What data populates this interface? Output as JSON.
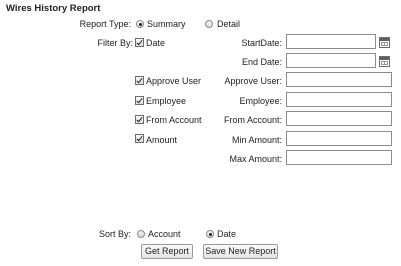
{
  "title": "Wires History Report",
  "report_type": {
    "label": "Report Type:",
    "options": [
      {
        "label": "Summary",
        "selected": true
      },
      {
        "label": "Detail",
        "selected": false
      }
    ]
  },
  "filter_by": {
    "label": "Filter By:",
    "options": [
      {
        "label": "Date",
        "checked": true
      },
      {
        "label": "Approve User",
        "checked": true
      },
      {
        "label": "Employee",
        "checked": true
      },
      {
        "label": "From Account",
        "checked": true
      },
      {
        "label": "Amount",
        "checked": true
      }
    ]
  },
  "fields": {
    "start_date": {
      "label": "StartDate:",
      "value": ""
    },
    "end_date": {
      "label": "End Date:",
      "value": ""
    },
    "approve_user": {
      "label": "Approve User:",
      "value": ""
    },
    "employee": {
      "label": "Employee:",
      "value": ""
    },
    "from_account": {
      "label": "From Account:",
      "value": ""
    },
    "min_amount": {
      "label": "Min Amount:",
      "value": ""
    },
    "max_amount": {
      "label": "Max Amount:",
      "value": ""
    }
  },
  "sort_by": {
    "label": "Sort By:",
    "options": [
      {
        "label": "Account",
        "selected": false
      },
      {
        "label": "Date",
        "selected": true
      }
    ]
  },
  "buttons": {
    "get_report": "Get Report",
    "save_new_report": "Save New Report"
  },
  "icons": {
    "calendar": "calendar-icon"
  }
}
